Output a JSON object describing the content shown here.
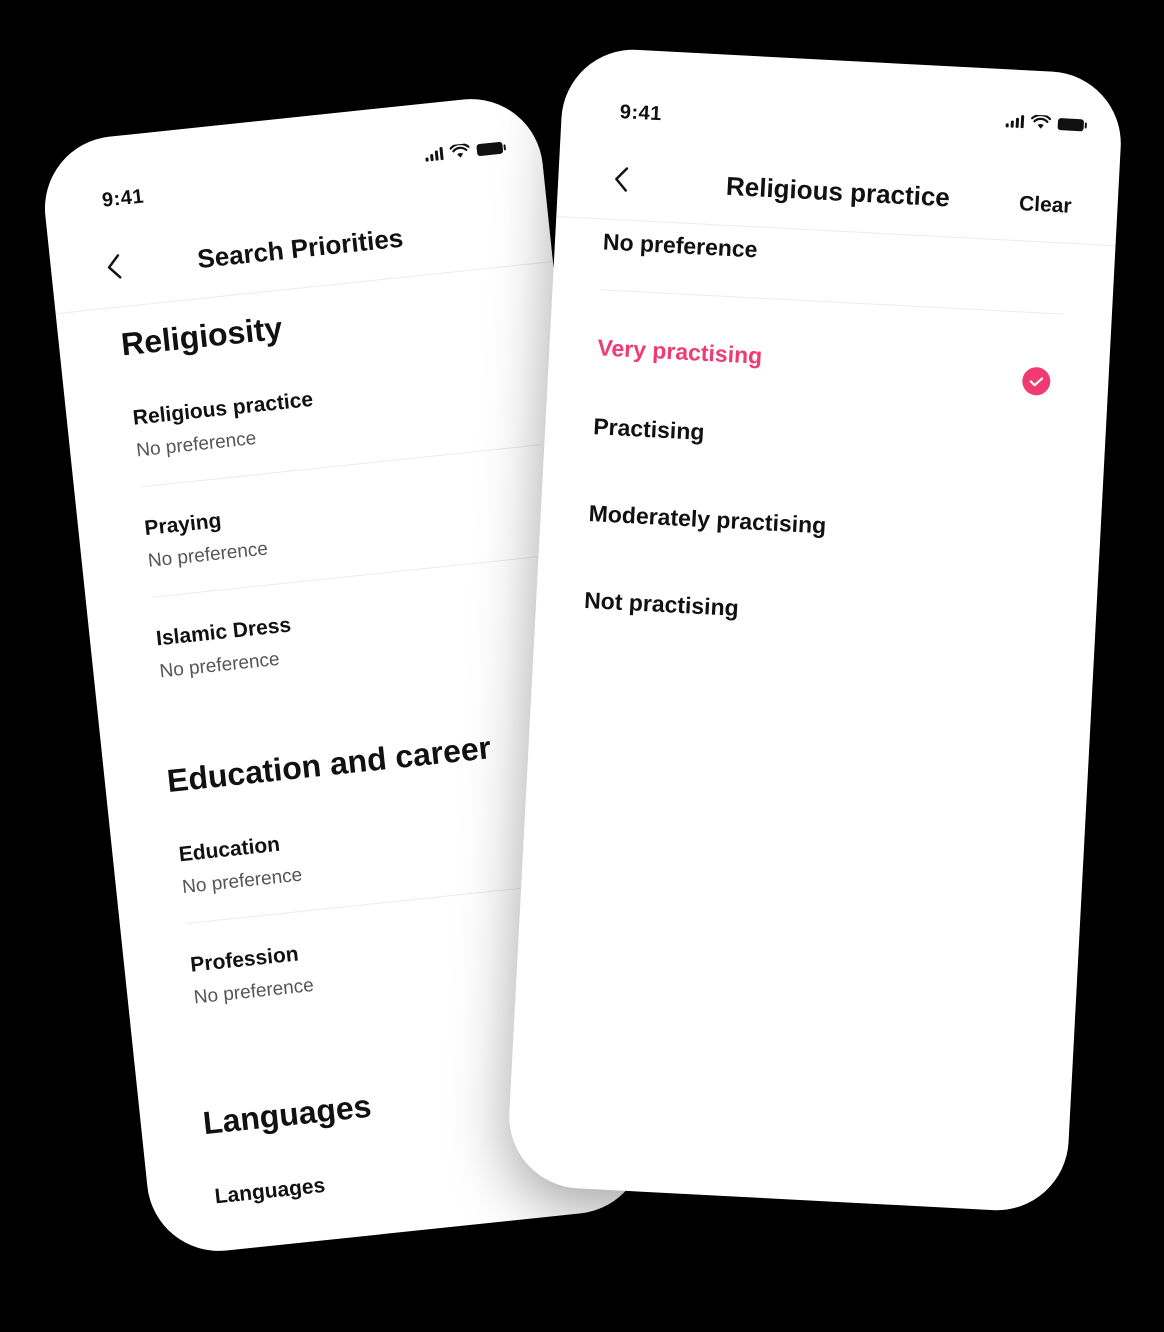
{
  "left_screen": {
    "status": {
      "time": "9:41"
    },
    "header": {
      "title": "Search Priorities"
    },
    "sections": [
      {
        "title": "Religiosity",
        "items": [
          {
            "label": "Religious practice",
            "value": "No preference"
          },
          {
            "label": "Praying",
            "value": "No preference"
          },
          {
            "label": "Islamic Dress",
            "value": "No preference"
          }
        ]
      },
      {
        "title": "Education and career",
        "items": [
          {
            "label": "Education",
            "value": "No preference"
          },
          {
            "label": "Profession",
            "value": "No preference"
          }
        ]
      },
      {
        "title": "Languages",
        "items": [
          {
            "label": "Languages"
          }
        ]
      }
    ]
  },
  "right_screen": {
    "status": {
      "time": "9:41"
    },
    "header": {
      "title": "Religious practice",
      "clear_label": "Clear"
    },
    "no_preference": "No preference",
    "options": [
      {
        "label": "Very practising",
        "selected": true
      },
      {
        "label": "Practising",
        "selected": false
      },
      {
        "label": "Moderately practising",
        "selected": false
      },
      {
        "label": "Not practising",
        "selected": false
      }
    ],
    "accent_color": "#f03a73"
  }
}
